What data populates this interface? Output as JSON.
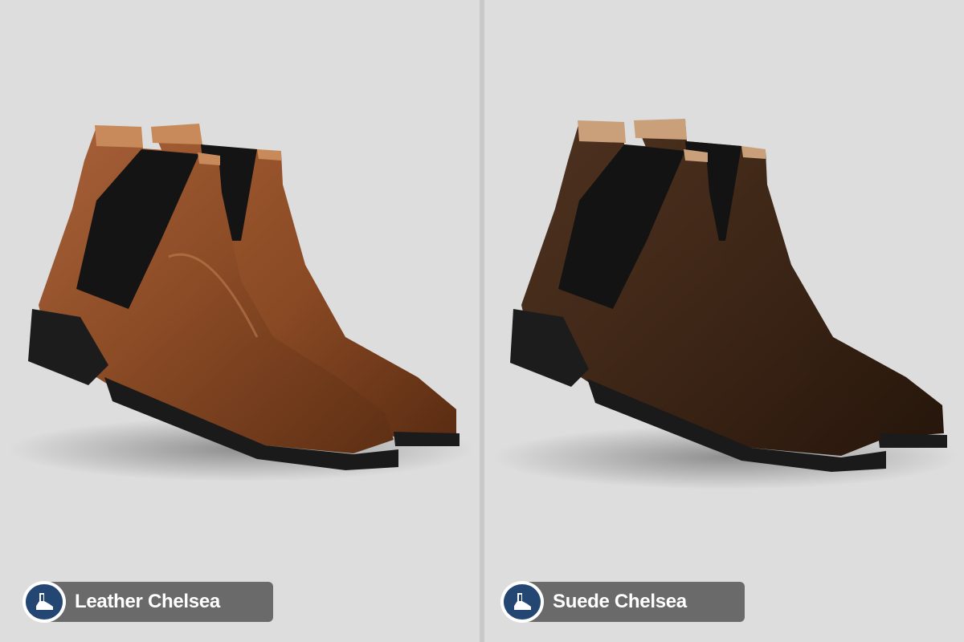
{
  "panels": [
    {
      "label": "Leather Chelsea",
      "icon": "chelsea-boot-icon",
      "boot_color": "#8a4a24"
    },
    {
      "label": "Suede Chelsea",
      "icon": "chelsea-boot-icon",
      "boot_color": "#3f2717"
    }
  ],
  "colors": {
    "background": "#dddddd",
    "divider": "#c9c9c9",
    "badge": "#244673",
    "label_pill": "#6a6a6a"
  }
}
